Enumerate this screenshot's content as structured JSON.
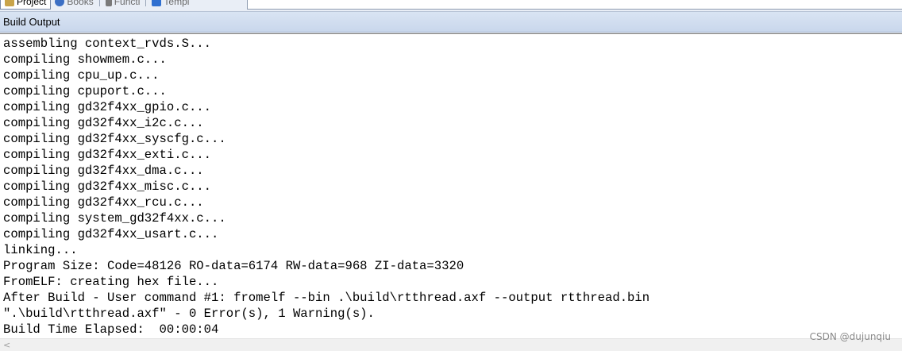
{
  "toolbar": {
    "tabs": [
      {
        "label": "Project",
        "active": true,
        "icon": "project-icon"
      },
      {
        "label": "Books",
        "active": false,
        "icon": "books-icon"
      },
      {
        "label": "Functi",
        "active": false,
        "icon": "functions-icon"
      },
      {
        "label": "Templ",
        "active": false,
        "icon": "templates-icon"
      }
    ]
  },
  "panel": {
    "title": "Build Output"
  },
  "output": {
    "lines": [
      "assembling context_rvds.S...",
      "compiling showmem.c...",
      "compiling cpu_up.c...",
      "compiling cpuport.c...",
      "compiling gd32f4xx_gpio.c...",
      "compiling gd32f4xx_i2c.c...",
      "compiling gd32f4xx_syscfg.c...",
      "compiling gd32f4xx_exti.c...",
      "compiling gd32f4xx_dma.c...",
      "compiling gd32f4xx_misc.c...",
      "compiling gd32f4xx_rcu.c...",
      "compiling system_gd32f4xx.c...",
      "compiling gd32f4xx_usart.c...",
      "linking...",
      "Program Size: Code=48126 RO-data=6174 RW-data=968 ZI-data=3320",
      "FromELF: creating hex file...",
      "After Build - User command #1: fromelf --bin .\\build\\rtthread.axf --output rtthread.bin",
      "\".\\build\\rtthread.axf\" - 0 Error(s), 1 Warning(s).",
      "Build Time Elapsed:  00:00:04"
    ]
  },
  "scrollbar": {
    "left_arrow": "<"
  },
  "watermark": "CSDN @dujunqiu"
}
